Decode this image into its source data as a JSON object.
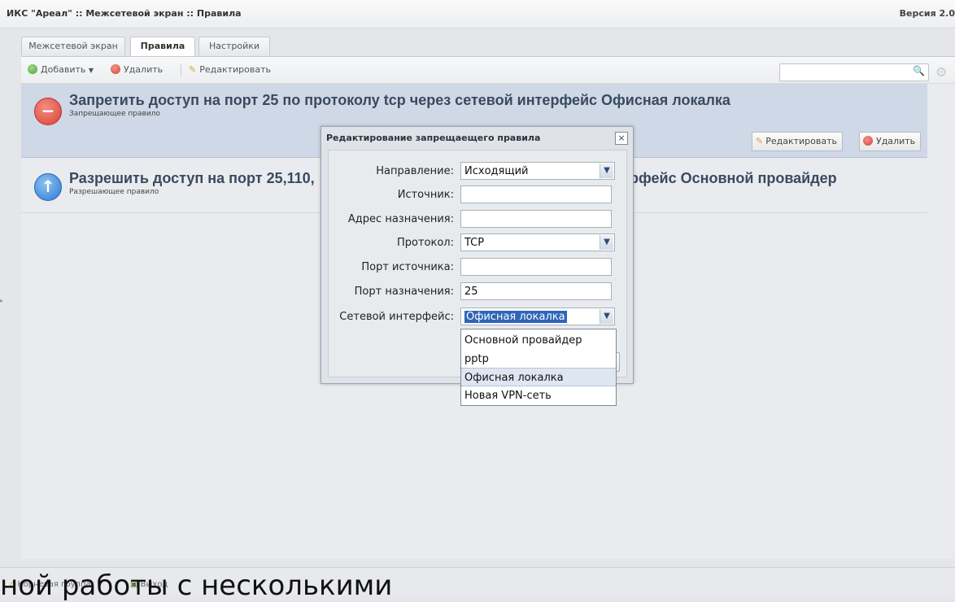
{
  "window": {
    "title": "ИКС \"Ареал\" :: Межсетевой экран :: Правила",
    "version": "Версия 2.0"
  },
  "tabs": [
    {
      "label": "Межсетевой экран",
      "active": false
    },
    {
      "label": "Правила",
      "active": true
    },
    {
      "label": "Настройки",
      "active": false
    }
  ],
  "toolbar": {
    "add_label": "Добавить",
    "delete_label": "Удалить",
    "edit_label": "Редактировать",
    "search_placeholder": ""
  },
  "rules": [
    {
      "type": "deny",
      "title": "Запретить доступ на порт 25 по протоколу tcp через сетевой интерфейс Офисная локалка",
      "subtitle": "Запрещающее правило",
      "edit_label": "Редактировать",
      "delete_label": "Удалить"
    },
    {
      "type": "allow",
      "title_left": "Разрешить доступ на порт 25,110,",
      "title_right": "рфейс Основной провайдер",
      "subtitle": "Разрешающее правило"
    }
  ],
  "dialog": {
    "title": "Редактирование запрещаещего правила",
    "close": "×",
    "fields": {
      "direction": {
        "label": "Направление:",
        "value": "Исходящий"
      },
      "source": {
        "label": "Источник:",
        "value": ""
      },
      "destination": {
        "label": "Адрес назначения:",
        "value": ""
      },
      "protocol": {
        "label": "Протокол:",
        "value": "TCP"
      },
      "source_port": {
        "label": "Порт источника:",
        "value": ""
      },
      "dest_port": {
        "label": "Порт назначения:",
        "value": "25"
      },
      "interface": {
        "label": "Сетевой интерфейс:",
        "value": "Офисная локалка"
      }
    },
    "interface_options": [
      "Основной провайдер",
      "pptp",
      "Офисная локалка",
      "Новая VPN-сеть"
    ]
  },
  "statusbar": {
    "group_label": "Корневая группа",
    "exit_label": "Выход"
  },
  "overlay_caption": "ной работы с несколькими",
  "colors": {
    "deny": "#d84233",
    "allow": "#2e7ad4",
    "selected_row": "#cfd8e6",
    "highlight": "#2e65b8"
  },
  "icons": {
    "add": "plus-circle-icon",
    "delete": "minus-circle-icon",
    "edit": "pencil-icon",
    "search": "magnifier-icon",
    "settings": "gear-icon",
    "deny": "stop-icon",
    "allow": "arrow-up-icon",
    "home": "home-icon",
    "exit": "exit-icon"
  }
}
